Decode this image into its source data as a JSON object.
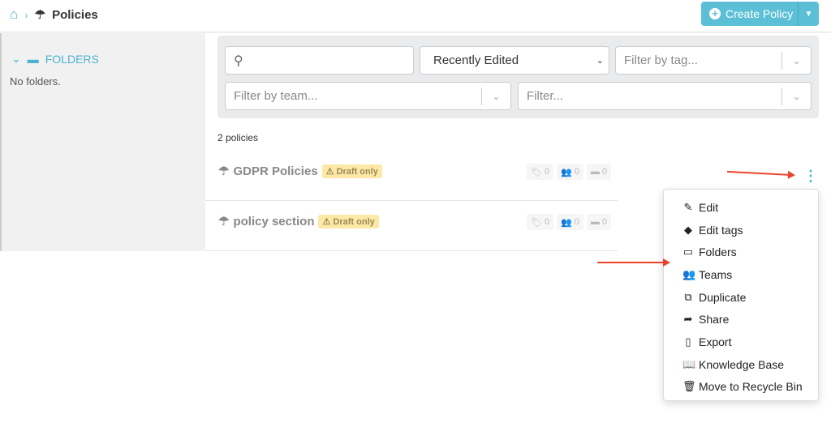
{
  "header": {
    "breadcrumb_title": "Policies",
    "create_label": "Create Policy"
  },
  "sidebar": {
    "folders_label": "FOLDERS",
    "empty_text": "No folders."
  },
  "filters": {
    "search_placeholder": "",
    "sort_value": "Recently Edited",
    "tag_placeholder": "Filter by tag...",
    "team_placeholder": "Filter by team...",
    "filter_placeholder": "Filter..."
  },
  "list": {
    "count": "2 policies",
    "items": [
      {
        "title": "GDPR Policies",
        "badge": "Draft only",
        "tags": "0",
        "teams": "0",
        "folders": "0"
      },
      {
        "title": "policy section",
        "badge": "Draft only",
        "tags": "0",
        "teams": "0",
        "folders": "0"
      }
    ]
  },
  "menu": {
    "items": [
      {
        "label": "Edit",
        "icon": "edit-icon"
      },
      {
        "label": "Edit tags",
        "icon": "tag-icon"
      },
      {
        "label": "Folders",
        "icon": "folder-icon"
      },
      {
        "label": "Teams",
        "icon": "users-icon"
      },
      {
        "label": "Duplicate",
        "icon": "copy-icon"
      },
      {
        "label": "Share",
        "icon": "share-icon"
      },
      {
        "label": "Export",
        "icon": "pdf-icon"
      },
      {
        "label": "Knowledge Base",
        "icon": "book-icon"
      },
      {
        "label": "Move to Recycle Bin",
        "icon": "trash-icon"
      }
    ]
  },
  "colors": {
    "accent": "#5bbfd6",
    "badge": "#fde8a6",
    "annotation_arrow": "#e8442c"
  }
}
